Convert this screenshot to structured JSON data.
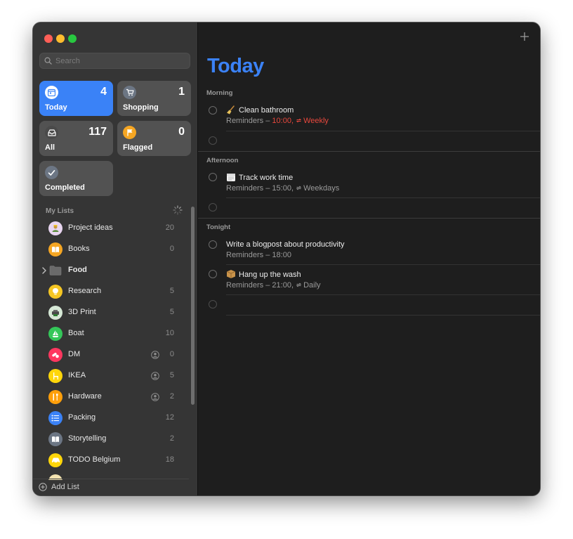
{
  "window": {
    "controls": [
      "close",
      "minimize",
      "zoom"
    ]
  },
  "sidebar": {
    "search": {
      "placeholder": "Search",
      "value": ""
    },
    "smart_lists": [
      {
        "label": "Today",
        "count": "4",
        "icon": "calendar-icon",
        "color": "#3a82f7",
        "active": true
      },
      {
        "label": "Shopping",
        "count": "1",
        "icon": "cart-icon",
        "color": "#6c7684"
      },
      {
        "label": "All",
        "count": "117",
        "icon": "tray-icon",
        "color": "#4a4a4a"
      },
      {
        "label": "Flagged",
        "count": "0",
        "icon": "flag-icon",
        "color": "#f5a623"
      },
      {
        "label": "Completed",
        "count": "",
        "icon": "checkmark-icon",
        "color": "#6c7684"
      }
    ],
    "my_lists_header": "My Lists",
    "lists": [
      {
        "name": "Project ideas",
        "count": "20",
        "icon": "person-icon",
        "color": "#e8d5f0"
      },
      {
        "name": "Books",
        "count": "0",
        "icon": "book-icon",
        "color": "#f5a623"
      },
      {
        "name": "Food",
        "count": "",
        "icon": "folder-icon",
        "color": "#6a6a6a"
      },
      {
        "name": "Research",
        "count": "5",
        "icon": "lightbulb-icon",
        "color": "#f5c623"
      },
      {
        "name": "3D Print",
        "count": "5",
        "icon": "printer-icon",
        "color": "#d0e6d0"
      },
      {
        "name": "Boat",
        "count": "10",
        "icon": "sailboat-icon",
        "color": "#34c759"
      },
      {
        "name": "DM",
        "count": "0",
        "icon": "pills-icon",
        "color": "#ff375f",
        "shared": true
      },
      {
        "name": "IKEA",
        "count": "5",
        "icon": "chair-icon",
        "color": "#ffd60a",
        "shared": true
      },
      {
        "name": "Hardware",
        "count": "2",
        "icon": "tools-icon",
        "color": "#ff9f0a",
        "shared": true
      },
      {
        "name": "Packing",
        "count": "12",
        "icon": "list-bullet-icon",
        "color": "#3a82f7"
      },
      {
        "name": "Storytelling",
        "count": "2",
        "icon": "book-open-icon",
        "color": "#6c7684"
      },
      {
        "name": "TODO Belgium",
        "count": "18",
        "icon": "car-icon",
        "color": "#ffd60a"
      }
    ],
    "add_list_label": "Add List"
  },
  "main": {
    "title": "Today",
    "sections": [
      {
        "label": "Morning"
      },
      {
        "label": "Afternoon"
      },
      {
        "label": "Tonight"
      }
    ],
    "reminders": [
      {
        "emoji": "🧹",
        "title": "Clean bathroom",
        "sub_prefix": "Reminders – ",
        "time": "10:00, ",
        "repeat": "Weekly",
        "overdue": true
      },
      {
        "emoji": "🗓",
        "title": "Track work time",
        "sub_prefix": "Reminders – ",
        "time": "15:00, ",
        "repeat": "Weekdays",
        "overdue": false
      },
      {
        "emoji": "",
        "title": "Write a blogpost about productivity",
        "sub_prefix": "Reminders – ",
        "time": "18:00",
        "repeat": "",
        "overdue": false
      },
      {
        "emoji": "📦",
        "title": "Hang up the wash",
        "sub_prefix": "Reminders – ",
        "time": "21:00, ",
        "repeat": "Daily",
        "overdue": false
      }
    ]
  },
  "colors": {
    "accent": "#3b82f6",
    "overdue": "#e8483d",
    "sidebar_bg": "#353535",
    "main_bg": "#1e1e1e"
  }
}
